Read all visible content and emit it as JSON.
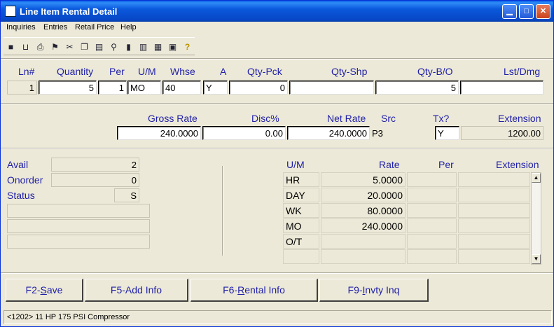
{
  "window": {
    "title": "Line Item Rental Detail"
  },
  "menu": {
    "items": [
      "Inquiries",
      "Entries",
      "Retail Price",
      "Help"
    ]
  },
  "toolbar": {
    "icons": [
      "save-icon",
      "basket-icon",
      "print-icon",
      "run-icon",
      "cut-icon",
      "copy-icon",
      "paste-icon",
      "find-icon",
      "door-icon",
      "chart-icon",
      "calculator-icon",
      "calendar-icon",
      "help-icon"
    ]
  },
  "line": {
    "headers": {
      "ln": "Ln#",
      "quantity": "Quantity",
      "per": "Per",
      "um": "U/M",
      "whse": "Whse",
      "a": "A",
      "qty_pck": "Qty-Pck",
      "qty_shp": "Qty-Shp",
      "qty_bo": "Qty-B/O",
      "lst_dmg": "Lst/Dmg"
    },
    "values": {
      "ln": "1",
      "quantity": "5",
      "per": "1",
      "um": "MO",
      "whse": "40",
      "a": "Y",
      "qty_pck": "0",
      "qty_shp": "",
      "qty_bo": "5",
      "lst_dmg": ""
    }
  },
  "pricing": {
    "headers": {
      "gross_rate": "Gross Rate",
      "disc": "Disc%",
      "net_rate": "Net Rate",
      "src": "Src",
      "tx": "Tx?",
      "extension": "Extension"
    },
    "values": {
      "gross_rate": "240.0000",
      "disc": "0.00",
      "net_rate": "240.0000",
      "src": "P3",
      "tx": "Y",
      "extension": "1200.00"
    }
  },
  "stock": {
    "avail_label": "Avail",
    "avail": "2",
    "onorder_label": "Onorder",
    "onorder": "0",
    "status_label": "Status",
    "status": "S"
  },
  "rates": {
    "headers": {
      "um": "U/M",
      "rate": "Rate",
      "per": "Per",
      "extension": "Extension"
    },
    "rows": [
      {
        "um": "HR",
        "rate": "5.0000",
        "per": "",
        "extension": ""
      },
      {
        "um": "DAY",
        "rate": "20.0000",
        "per": "",
        "extension": ""
      },
      {
        "um": "WK",
        "rate": "80.0000",
        "per": "",
        "extension": ""
      },
      {
        "um": "MO",
        "rate": "240.0000",
        "per": "",
        "extension": ""
      },
      {
        "um": "O/T",
        "rate": "",
        "per": "",
        "extension": ""
      },
      {
        "um": "",
        "rate": "",
        "per": "",
        "extension": ""
      }
    ]
  },
  "buttons": {
    "save": {
      "pre": "F2-",
      "u": "S",
      "post": "ave"
    },
    "add_info": {
      "pre": "F5-Add Info",
      "u": "",
      "post": ""
    },
    "rental_info": {
      "pre": "F6-",
      "u": "R",
      "post": "ental Info"
    },
    "invty": {
      "pre": "F9-",
      "u": "I",
      "post": "nvty Inq"
    }
  },
  "statusbar": {
    "text": "<1202> 11 HP 175 PSI Compressor"
  }
}
